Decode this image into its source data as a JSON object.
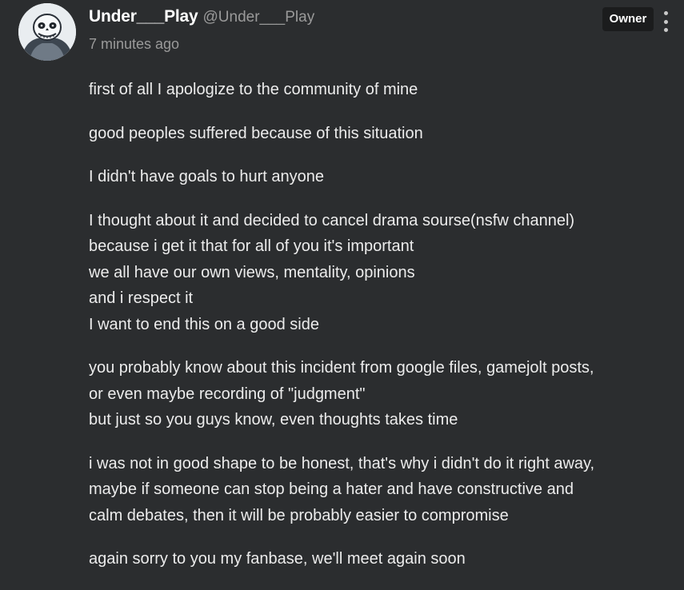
{
  "author": {
    "display_name": "Under___Play",
    "handle": "@Under___Play",
    "avatar_icon": "skeleton-avatar-icon"
  },
  "post": {
    "timestamp": "7 minutes ago",
    "badge": "Owner",
    "menu_icon": "more-vertical-icon",
    "paragraphs": [
      [
        "first of all I apologize to the community of mine"
      ],
      [
        "good peoples suffered because of this situation"
      ],
      [
        "I didn't have goals to hurt anyone"
      ],
      [
        "I thought about it and decided to cancel drama sourse(nsfw channel)",
        "because i get it that for all of you it's important",
        "we all have our own views, mentality, opinions",
        "and i respect it",
        "I want to end this on a good side"
      ],
      [
        "you probably know about this incident from google files, gamejolt posts,",
        "or even maybe recording of \"judgment\"",
        "but just so you guys know, even thoughts takes time"
      ],
      [
        "i was not in good shape to be honest, that's why i didn't do it right away,",
        "maybe if someone can stop being a hater and have constructive and",
        "calm debates, then it will be probably easier to compromise"
      ],
      [
        "again sorry to you my fanbase, we'll meet again soon"
      ]
    ]
  },
  "colors": {
    "background": "#2b2d2f",
    "text": "#ececec",
    "muted": "#9a9a9a",
    "badge_bg": "#1b1c1d"
  }
}
